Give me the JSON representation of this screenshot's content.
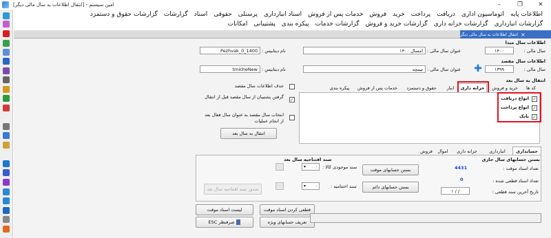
{
  "window": {
    "title": "امین سیستم - [انتقال اطلاعات به سال مالی دیگر]",
    "minimize": "–",
    "maximize": "❐",
    "close": "✕"
  },
  "menu": {
    "row1": [
      "اطلاعات پایه",
      "اتوماسیون اداری",
      "دریافت",
      "پرداخت",
      "خرید",
      "فروش",
      "خدمات پس از فروش",
      "اسناد انبارداری",
      "پرسنلی",
      "حقوقی",
      "اسناد",
      "گزارشات",
      "گزارشات حقوق و دستمزد"
    ],
    "row2": [
      "گزارشات انبارداری",
      "گزارشات خزانه داری",
      "گزارشات خرید و فروش",
      "گزارشات خدمات",
      "پیکره بندی",
      "پشتیبانی",
      "امکانات"
    ],
    "nav_arrows": "◂ ▸"
  },
  "doc_tab": {
    "label": "انتقال اطلاعات به سال مالی دیگر",
    "close": "×"
  },
  "source": {
    "heading": "اطلاعات سال مبدا",
    "year_label": "سال مالی :",
    "year_value": "۱۴۰۰",
    "title_label": "عنوان سال مالی :",
    "title_value": "امسال ۱۴۰۰",
    "db_label": "نام دیتابیس :",
    "db_value": "Pezhvak_0_1400"
  },
  "dest": {
    "heading": "اطلاعات سال مقصد",
    "year_label": "سال مالی :",
    "year_value": "۱۳۹۹",
    "title_label": "عنوان سال مالی :",
    "title_value": "تیمچه",
    "db_label": "نام دیتابیس :",
    "db_value": "tmicheNew"
  },
  "transfer": {
    "heading": "انتقال به سال بعد",
    "tabs": [
      "کد ها",
      "خرید و فروش",
      "خزانه داری",
      "انبار",
      "حقوق و دستمزد",
      "خدمات پس از فروش",
      "پیکره بندی"
    ],
    "treasury_items": [
      {
        "label": "انواع دریافت",
        "checked": true
      },
      {
        "label": "انواع پرداخت",
        "checked": true
      },
      {
        "label": "بانک",
        "checked": true
      }
    ],
    "options": [
      {
        "label": "حذف اطلاعات سال مقصد",
        "checked": false
      },
      {
        "label": "گرفتن پشتیبان از سال مقصد قبل از انتقال",
        "checked": true
      },
      {
        "label": "انتخاب سال مقصد به عنوان سال فعال بعد از انجام عملیات",
        "checked": false
      }
    ],
    "button": "انتقال به سال بعد"
  },
  "bottom": {
    "tabs": [
      "حسابداری",
      "انبارداری",
      "خزانه داری",
      "اموال",
      "فروش"
    ],
    "close_heading": "بستن حسابهای سال جاری",
    "temp_count_label": "تعداد اسناد موقت :",
    "temp_count_value": "4431",
    "final_count_label": "تعداد اسناد قطعی شده :",
    "final_count_value": "0",
    "last_date_label": "تاریخ آخرین سند قطعی :",
    "last_date_value": "/ / ۱",
    "close_temp_btn": "بستن حسابهای موقت",
    "close_perm_btn": "بستن حسابهای دائم",
    "opening_heading": "سند افتتاحیه سال بعد",
    "inventory_label": "سند موجودی کالا :",
    "opening_label": "سند اختتامیه :",
    "combo_value": "۰",
    "combo_arrow": "▾",
    "issue_btn": "صدور سند افتتاحیه سال بعد"
  },
  "footer": {
    "temp_list_btn": "لیست اسناد موقت",
    "finalize_btn": "قطعی کردن اسناد موقت",
    "esc_btn": "صرفنظر ESC",
    "special_btn": "تعریف حسابهای ویژه"
  },
  "colors": {
    "accent": "#3a6fc4",
    "highlight": "#e3121f",
    "value_blue": "#1f3fd6"
  }
}
